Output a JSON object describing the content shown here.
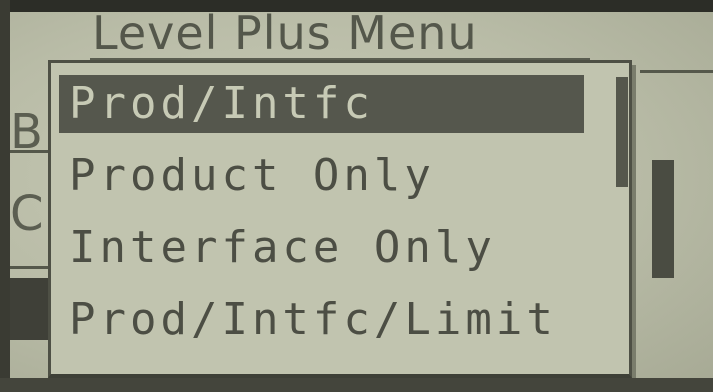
{
  "screen": {
    "title": "Level Plus Menu",
    "background_letters": [
      "B",
      "C"
    ]
  },
  "popup_menu": {
    "items": [
      {
        "label": "Prod/Intfc",
        "selected": true
      },
      {
        "label": "Product Only",
        "selected": false
      },
      {
        "label": "Interface Only",
        "selected": false
      },
      {
        "label": "Prod/Intfc/Limit",
        "selected": false
      }
    ]
  },
  "colors": {
    "lcd_background": "#c1c4af",
    "pixel_dark": "#4c4e44",
    "selection_background": "#55574d",
    "selection_text": "#c7cab5"
  }
}
